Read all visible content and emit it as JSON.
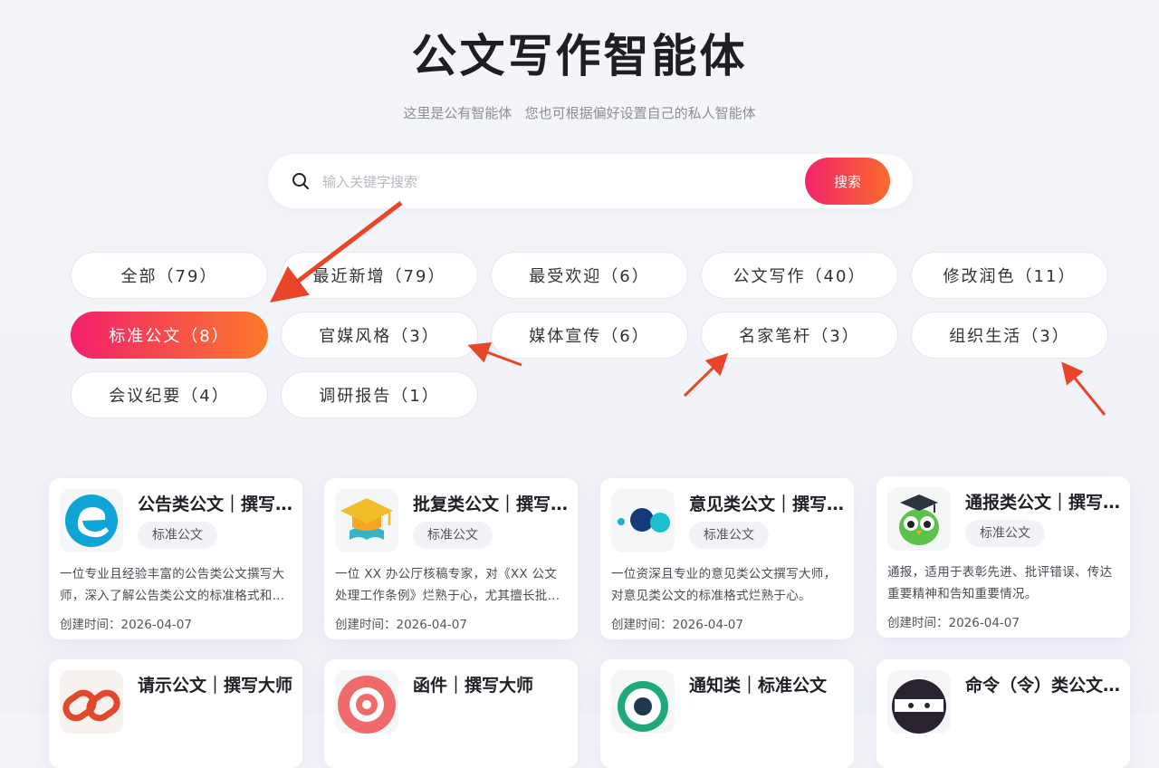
{
  "header": {
    "title": "公文写作智能体",
    "subtitle": "这里是公有智能体   您也可根据偏好设置自己的私人智能体"
  },
  "search": {
    "placeholder": "输入关键字搜索",
    "button_label": "搜索"
  },
  "colors": {
    "accent_start": "#f2206c",
    "accent_end": "#fb7a2a",
    "arrow": "#e8452a"
  },
  "categories": [
    {
      "label": "全部（79）",
      "active": false
    },
    {
      "label": "最近新增（79）",
      "active": false
    },
    {
      "label": "最受欢迎（6）",
      "active": false
    },
    {
      "label": "公文写作（40）",
      "active": false
    },
    {
      "label": "修改润色（11）",
      "active": false
    },
    {
      "label": "标准公文（8）",
      "active": true
    },
    {
      "label": "官媒风格（3）",
      "active": false
    },
    {
      "label": "媒体宣传（6）",
      "active": false
    },
    {
      "label": "名家笔杆（3）",
      "active": false
    },
    {
      "label": "组织生活（3）",
      "active": false
    },
    {
      "label": "会议纪要（4）",
      "active": false
    },
    {
      "label": "调研报告（1）",
      "active": false
    }
  ],
  "cards": [
    {
      "title": "公告类公文｜撰写大师",
      "tag": "标准公文",
      "description": "一位专业且经验丰富的公告类公文撰写大师，深入了解公告类公文的标准格式和写作规范。",
      "date_label": "创建时间：2026-04-07",
      "icon": "blue-e-logo-icon"
    },
    {
      "title": "批复类公文｜撰写大师",
      "tag": "标准公文",
      "description": "一位 XX 办公厅核稿专家，对《XX 公文处理工作条例》烂熟于心，尤其擅长批复类公文写作。",
      "date_label": "创建时间：2026-04-07",
      "icon": "graduation-cap-icon"
    },
    {
      "title": "意见类公文｜撰写大师",
      "tag": "标准公文",
      "description": "一位资深且专业的意见类公文撰写大师，对意见类公文的标准格式烂熟于心。",
      "date_label": "创建时间：2026-04-07",
      "icon": "blue-dots-icon"
    },
    {
      "title": "通报类公文｜撰写大师",
      "tag": "标准公文",
      "description": "通报，适用于表彰先进、批评错误、传达重要精神和告知重要情况。",
      "date_label": "创建时间：2026-04-07",
      "icon": "owl-icon"
    },
    {
      "title": "请示公文｜撰写大师",
      "tag": "",
      "description": "",
      "date_label": "",
      "icon": "red-chain-icon"
    },
    {
      "title": "函件｜撰写大师",
      "tag": "",
      "description": "",
      "date_label": "",
      "icon": "red-target-icon"
    },
    {
      "title": "通知类｜标准公文",
      "tag": "",
      "description": "",
      "date_label": "",
      "icon": "green-ring-icon"
    },
    {
      "title": "命令（令）类公文｜撰写大师",
      "tag": "",
      "description": "",
      "date_label": "",
      "icon": "ninja-icon"
    }
  ]
}
